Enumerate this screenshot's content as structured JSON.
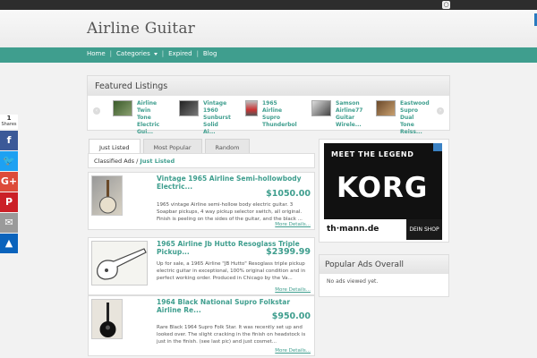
{
  "site": {
    "title": "Airline Guitar",
    "rss_icon": "rss-icon"
  },
  "nav": {
    "items": [
      {
        "label": "Home"
      },
      {
        "label": "Categories"
      },
      {
        "label": "Expired"
      },
      {
        "label": "Blog"
      }
    ]
  },
  "featured": {
    "title": "Featured Listings",
    "items": [
      {
        "label": "Airline Twin Tone Electric Gui..."
      },
      {
        "label": "Vintage 1960 Sunburst Solid Ai..."
      },
      {
        "label": "1965 Airline Supro Thunderbol"
      },
      {
        "label": "Samson Airline77 Guitar Wirele..."
      },
      {
        "label": "Eastwood Supro Dual Tone Reiss..."
      }
    ]
  },
  "tabs": [
    {
      "label": "Just Listed"
    },
    {
      "label": "Most Popular"
    },
    {
      "label": "Random"
    }
  ],
  "breadcrumb": {
    "root": "Classified Ads",
    "sep": "/",
    "current": "Just Listed"
  },
  "listings": [
    {
      "title": "Vintage 1965 Airline Semi-hollowbody Electric...",
      "price": "$1050.00",
      "desc": "1965 vintage Airline semi-hollow body electric guitar. 3 Soapbar pickups, 4 way pickup selector switch, all original. Finish is peeling on the sides of the guitar, and the black ...",
      "more": "More Details..."
    },
    {
      "title": "1965 Airline Jb Hutto Resoglass Triple Pickup...",
      "price": "$2399.99",
      "desc": "Up for sale, a 1965 Airline \"JB Hutto\" Resoglass triple pickup electric guitar in exceptional, 100% original condition and in perfect working order. Produced in Chicago by the Va...",
      "more": "More Details..."
    },
    {
      "title": "1964 Black National Supro Folkstar Airline Re...",
      "price": "$950.00",
      "desc": "Rare Black 1964 Supro Folk Star. It was recently set up and looked over. The slight cracking in the finish on headstock is just in the finish. (see last pic) and just cosmet...",
      "more": "More Details..."
    }
  ],
  "ad": {
    "tagline": "MEET THE LEGEND",
    "brand": "KORG",
    "shop": "th·mann.de",
    "cta": "DEIN SHOP"
  },
  "popular": {
    "title": "Popular Ads Overall",
    "empty": "No ads viewed yet."
  },
  "share": {
    "count": "1",
    "label": "Shares",
    "buttons": [
      {
        "glyph": "f",
        "color": "#3b5998",
        "icon": "facebook-icon"
      },
      {
        "glyph": "🐦",
        "color": "#1da1f2",
        "icon": "twitter-icon"
      },
      {
        "glyph": "G+",
        "color": "#dd4b39",
        "icon": "google-plus-icon"
      },
      {
        "glyph": "P",
        "color": "#cb2027",
        "icon": "pinterest-icon"
      },
      {
        "glyph": "✉",
        "color": "#9a9a9a",
        "icon": "email-icon"
      },
      {
        "glyph": "▲",
        "color": "#0a63bc",
        "icon": "sumome-icon"
      }
    ]
  },
  "colors": {
    "accent": "#3f9e8e",
    "topbar": "#2d2d2d"
  }
}
